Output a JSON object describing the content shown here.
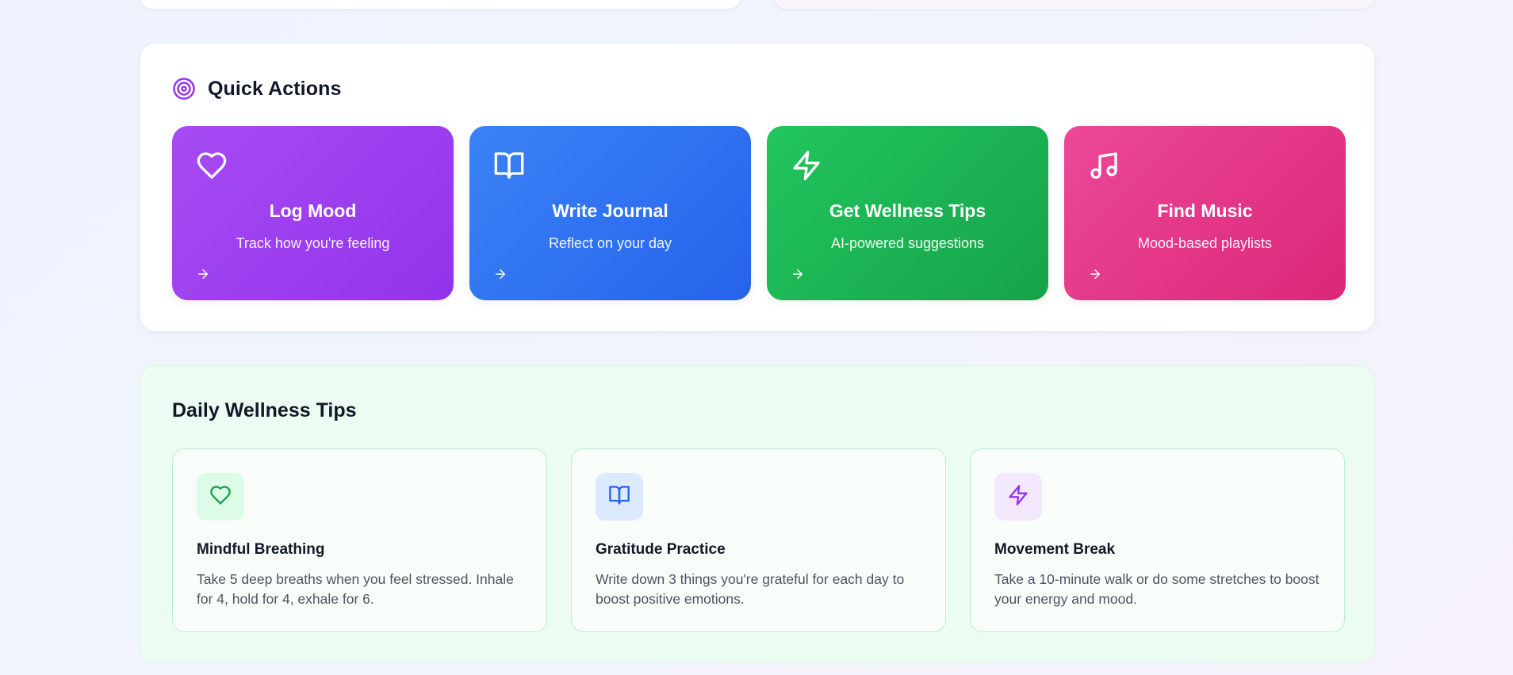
{
  "quick_actions": {
    "title": "Quick Actions",
    "icon": "target-icon",
    "items": [
      {
        "title": "Log Mood",
        "subtitle": "Track how you're feeling",
        "icon": "heart-icon",
        "color": "#a855f7"
      },
      {
        "title": "Write Journal",
        "subtitle": "Reflect on your day",
        "icon": "book-open-icon",
        "color": "#3b82f6"
      },
      {
        "title": "Get Wellness Tips",
        "subtitle": "AI-powered suggestions",
        "icon": "zap-icon",
        "color": "#22c55e"
      },
      {
        "title": "Find Music",
        "subtitle": "Mood-based playlists",
        "icon": "music-icon",
        "color": "#ec4899"
      }
    ]
  },
  "wellness_tips": {
    "title": "Daily Wellness Tips",
    "items": [
      {
        "title": "Mindful Breathing",
        "text": "Take 5 deep breaths when you feel stressed. Inhale for 4, hold for 4, exhale for 6.",
        "icon": "heart-icon",
        "color": "#16a34a"
      },
      {
        "title": "Gratitude Practice",
        "text": "Write down 3 things you're grateful for each day to boost positive emotions.",
        "icon": "book-open-icon",
        "color": "#2563eb"
      },
      {
        "title": "Movement Break",
        "text": "Take a 10-minute walk or do some stretches to boost your energy and mood.",
        "icon": "zap-icon",
        "color": "#9333ea"
      }
    ]
  }
}
